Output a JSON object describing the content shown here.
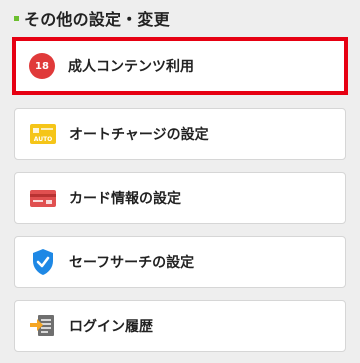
{
  "section": {
    "title": "その他の設定・変更"
  },
  "items": [
    {
      "label": "成人コンテンツ利用",
      "icon": "age-18-badge-icon",
      "badge_text": "18",
      "highlighted": true
    },
    {
      "label": "オートチャージの設定",
      "icon": "auto-charge-card-icon",
      "badge_text": "AUTO"
    },
    {
      "label": "カード情報の設定",
      "icon": "credit-card-icon"
    },
    {
      "label": "セーフサーチの設定",
      "icon": "shield-check-icon"
    },
    {
      "label": "ログイン履歴",
      "icon": "login-history-icon"
    }
  ],
  "colors": {
    "accent_green": "#6cbf2f",
    "highlight_red": "#e60012",
    "badge_red": "#e03a3a",
    "card_yellow": "#f5c518",
    "card_red": "#e05050",
    "shield_blue": "#1e88e5"
  }
}
